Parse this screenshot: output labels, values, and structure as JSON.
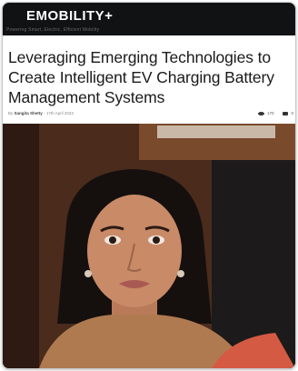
{
  "site": {
    "brand": "EMOBILITY+",
    "tagline": "Powering Smart, Electric, Efficient Mobility"
  },
  "article": {
    "headline": "Leveraging Emerging Technologies to Create Intelligent EV Charging Battery Management Systems",
    "author": "Sangita Shetty",
    "separator": "-",
    "date": "17th April 2023",
    "views": "170",
    "comments": "0"
  },
  "colors": {
    "header_bg": "#111214",
    "headline_text": "#1a1a1a"
  }
}
